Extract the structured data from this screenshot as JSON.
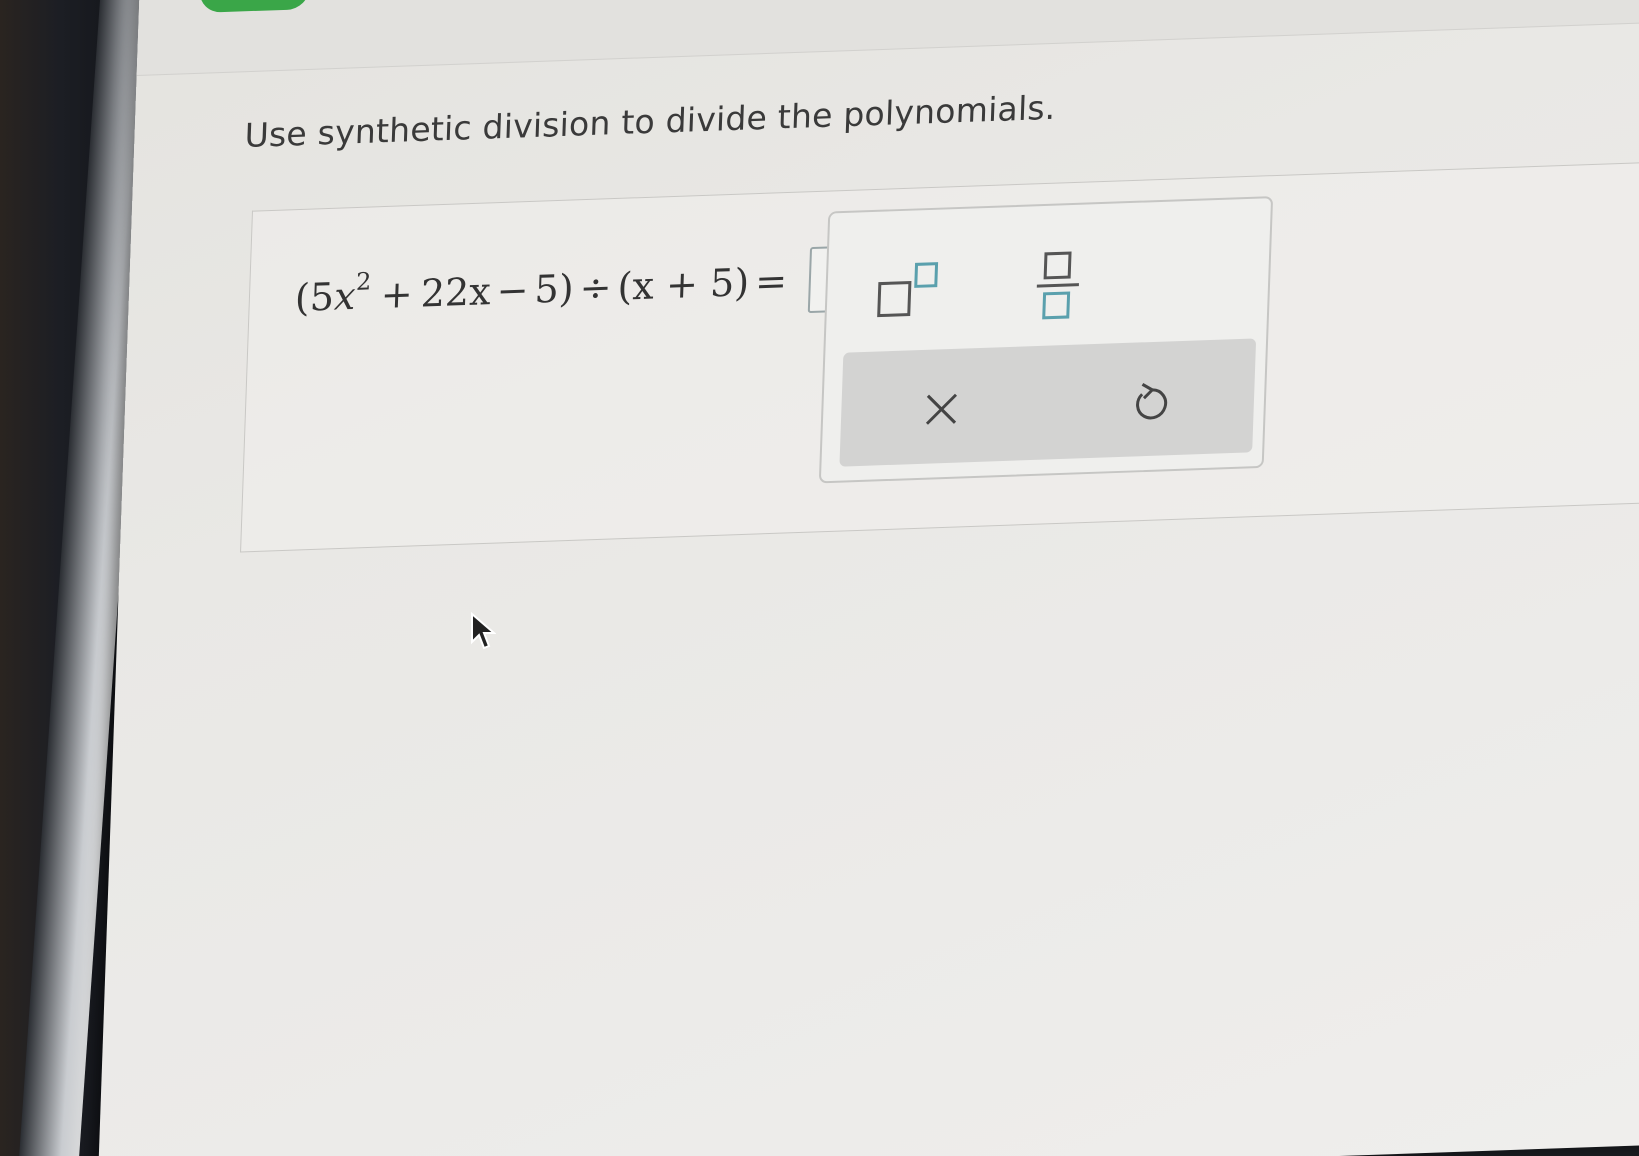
{
  "instruction": "Use synthetic division to divide the polynomials.",
  "equation": {
    "open_paren": "(",
    "term1_coef": "5",
    "term1_var": "x",
    "term1_exp": "2",
    "plus1": "+",
    "term2": "22x",
    "minus": "−",
    "term3": "5",
    "close_paren": ")",
    "divide": "÷",
    "divisor": "(x + 5)",
    "equals": "="
  },
  "answer": {
    "value": ""
  },
  "palette": {
    "buttons": [
      {
        "icon": "exponent-icon"
      },
      {
        "icon": "fraction-icon"
      }
    ],
    "actions": [
      {
        "icon": "clear-icon"
      },
      {
        "icon": "undo-icon"
      }
    ]
  },
  "colors": {
    "accent_green": "#3aa648",
    "box_teal": "#5aa0ad",
    "text": "#333333"
  }
}
